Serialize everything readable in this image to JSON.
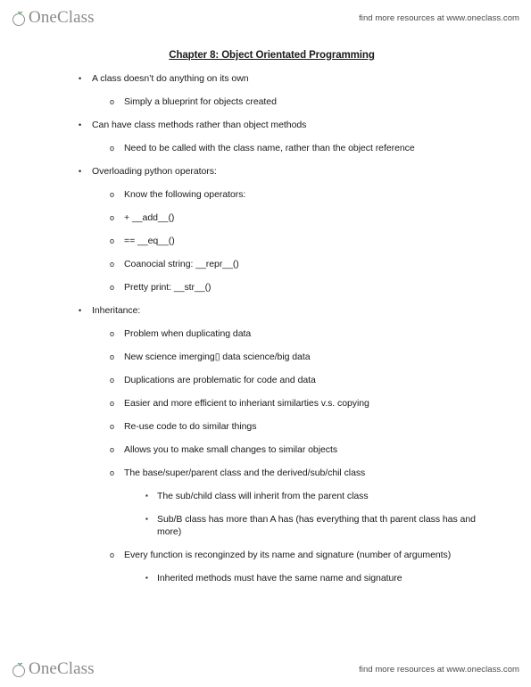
{
  "brand": {
    "name_o": "O",
    "name_rest": "neClass",
    "leaf_color": "#2e9e52",
    "text_color": "#8a8a8a",
    "icon": "leaf-sprout-icon"
  },
  "header": {
    "resources_text": "find more resources at www.oneclass.com"
  },
  "footer": {
    "resources_text": "find more resources at www.oneclass.com"
  },
  "document": {
    "title": "Chapter 8: Object Orientated Programming",
    "bullets": {
      "level1": "•",
      "level2": "o",
      "level3": "▪"
    },
    "outline": [
      {
        "level": 1,
        "text": "A class doesn’t do anything on its own"
      },
      {
        "level": 2,
        "text": "Simply a blueprint for objects created"
      },
      {
        "level": 1,
        "text": "Can have class methods rather than object methods"
      },
      {
        "level": 2,
        "text": "Need to be called with the class name, rather than the object reference"
      },
      {
        "level": 1,
        "text": "Overloading python operators:"
      },
      {
        "level": 2,
        "text": "Know the following operators:"
      },
      {
        "level": 2,
        "text": "+ __add__()"
      },
      {
        "level": 2,
        "text": "== __eq__()"
      },
      {
        "level": 2,
        "text": "Coanocial string: __repr__()"
      },
      {
        "level": 2,
        "text": "Pretty print: __str__()"
      },
      {
        "level": 1,
        "text": "Inheritance:"
      },
      {
        "level": 2,
        "text": "Problem when duplicating data"
      },
      {
        "level": 2,
        "text": "New science imerging▯ data science/big data"
      },
      {
        "level": 2,
        "text": "Duplications are problematic for code and data"
      },
      {
        "level": 2,
        "text": "Easier and more efficient to inheriant similarties v.s. copying"
      },
      {
        "level": 2,
        "text": "Re-use code to do similar things"
      },
      {
        "level": 2,
        "text": "Allows you to make small changes to similar objects"
      },
      {
        "level": 2,
        "text": "The base/super/parent class and the derived/sub/chil class"
      },
      {
        "level": 3,
        "text": "The sub/child class will inherit from the parent class"
      },
      {
        "level": 3,
        "text": "Sub/B class has more than A has (has everything that th parent class has and more)"
      },
      {
        "level": 2,
        "text": "Every function is reconginzed by its name and signature (number of arguments)"
      },
      {
        "level": 3,
        "text": "Inherited methods must have the same name and signature"
      }
    ]
  }
}
